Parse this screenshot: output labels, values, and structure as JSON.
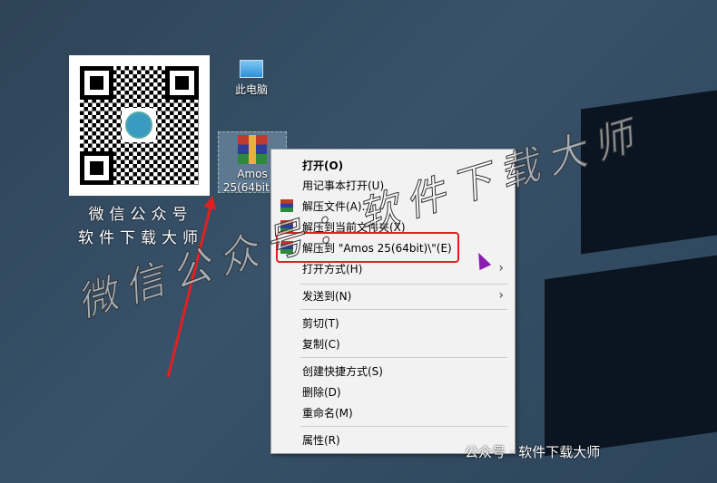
{
  "qr": {
    "caption_line1": "微信公众号",
    "caption_line2": "软件下载大师"
  },
  "desktop": {
    "icons": [
      {
        "label": "此电脑"
      },
      {
        "label": "Amos 25(64bit).r"
      }
    ]
  },
  "context_menu": {
    "items": [
      {
        "label": "打开(O)",
        "bold": true
      },
      {
        "label": "用记事本打开(U)"
      },
      {
        "label": "解压文件(A)..."
      },
      {
        "label": "解压到当前文件夹(X)"
      },
      {
        "label": "解压到 \"Amos 25(64bit)\\\"(E)"
      },
      {
        "label": "打开方式(H)"
      },
      {
        "label": "发送到(N)"
      },
      {
        "label": "剪切(T)"
      },
      {
        "label": "复制(C)"
      },
      {
        "label": "创建快捷方式(S)"
      },
      {
        "label": "删除(D)"
      },
      {
        "label": "重命名(M)"
      },
      {
        "label": "属性(R)"
      }
    ]
  },
  "watermark": "微信公众号：软件下载大师",
  "footer": "公众号 · 软件下载大师"
}
